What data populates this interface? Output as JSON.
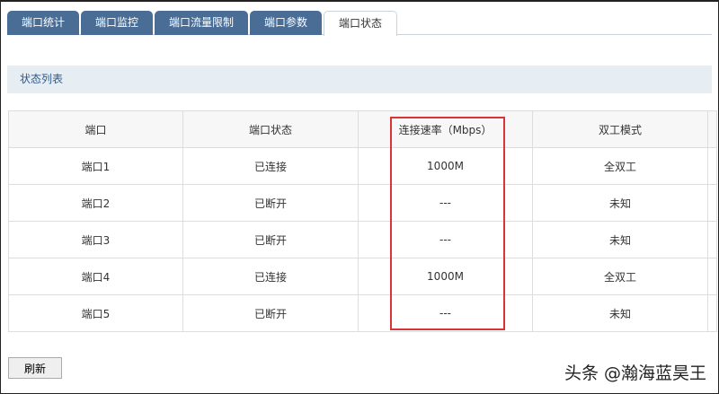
{
  "tabs": [
    "端口统计",
    "端口监控",
    "端口流量限制",
    "端口参数",
    "端口状态"
  ],
  "active_tab": 4,
  "section_title": "状态列表",
  "table": {
    "headers": [
      "端口",
      "端口状态",
      "连接速率（Mbps）",
      "双工模式"
    ],
    "rows": [
      [
        "端口1",
        "已连接",
        "1000M",
        "全双工"
      ],
      [
        "端口2",
        "已断开",
        "---",
        "未知"
      ],
      [
        "端口3",
        "已断开",
        "---",
        "未知"
      ],
      [
        "端口4",
        "已连接",
        "1000M",
        "全双工"
      ],
      [
        "端口5",
        "已断开",
        "---",
        "未知"
      ]
    ]
  },
  "refresh_label": "刷新",
  "watermark": "头条 @瀚海蓝昊王",
  "colors": {
    "tab": "#4a6d95",
    "highlight": "#d9343a",
    "section_bg": "#e6edf3"
  }
}
